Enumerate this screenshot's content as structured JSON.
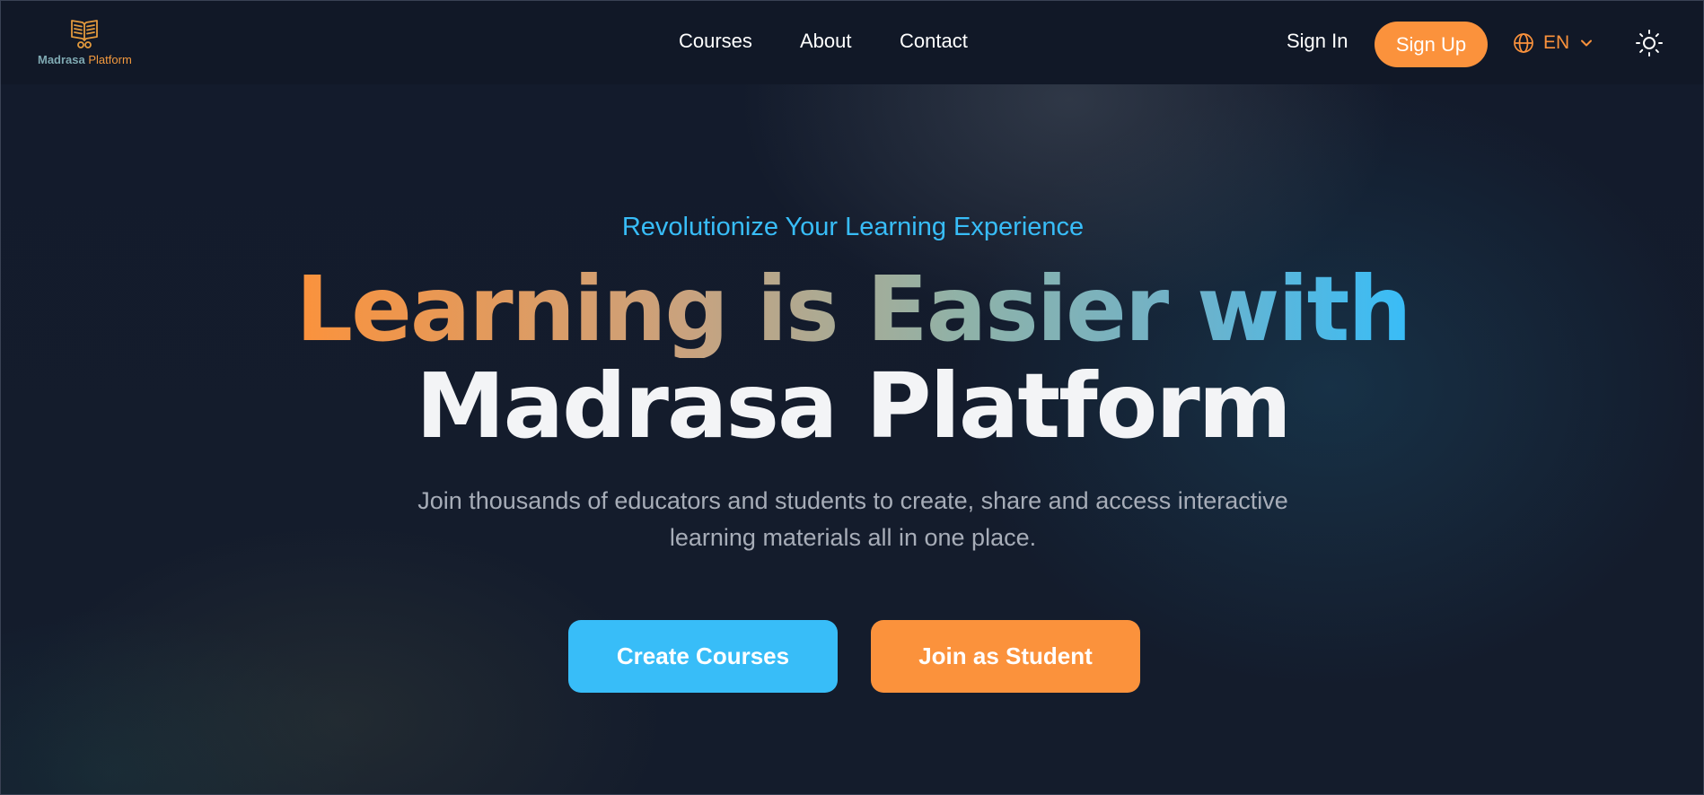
{
  "brand": {
    "name_part1": "Madrasa",
    "name_part2": "Platform",
    "icon": "open-book-icon",
    "accent_color": "#fb923c",
    "secondary_color": "#38bdf8"
  },
  "nav": {
    "items": [
      {
        "label": "Courses"
      },
      {
        "label": "About"
      },
      {
        "label": "Contact"
      }
    ]
  },
  "auth": {
    "sign_in_label": "Sign In",
    "sign_up_label": "Sign Up"
  },
  "language": {
    "icon": "globe-icon",
    "selected": "EN",
    "dropdown_icon": "chevron-down-icon"
  },
  "theme_toggle": {
    "icon": "sun-icon"
  },
  "hero": {
    "tagline": "Revolutionize Your Learning Experience",
    "headline_line1": "Learning is Easier with",
    "headline_line2": "Madrasa Platform",
    "subtitle": "Join thousands of educators and students to create, share and access interactive learning materials all in one place.",
    "primary_cta": "Create Courses",
    "secondary_cta": "Join as Student"
  }
}
